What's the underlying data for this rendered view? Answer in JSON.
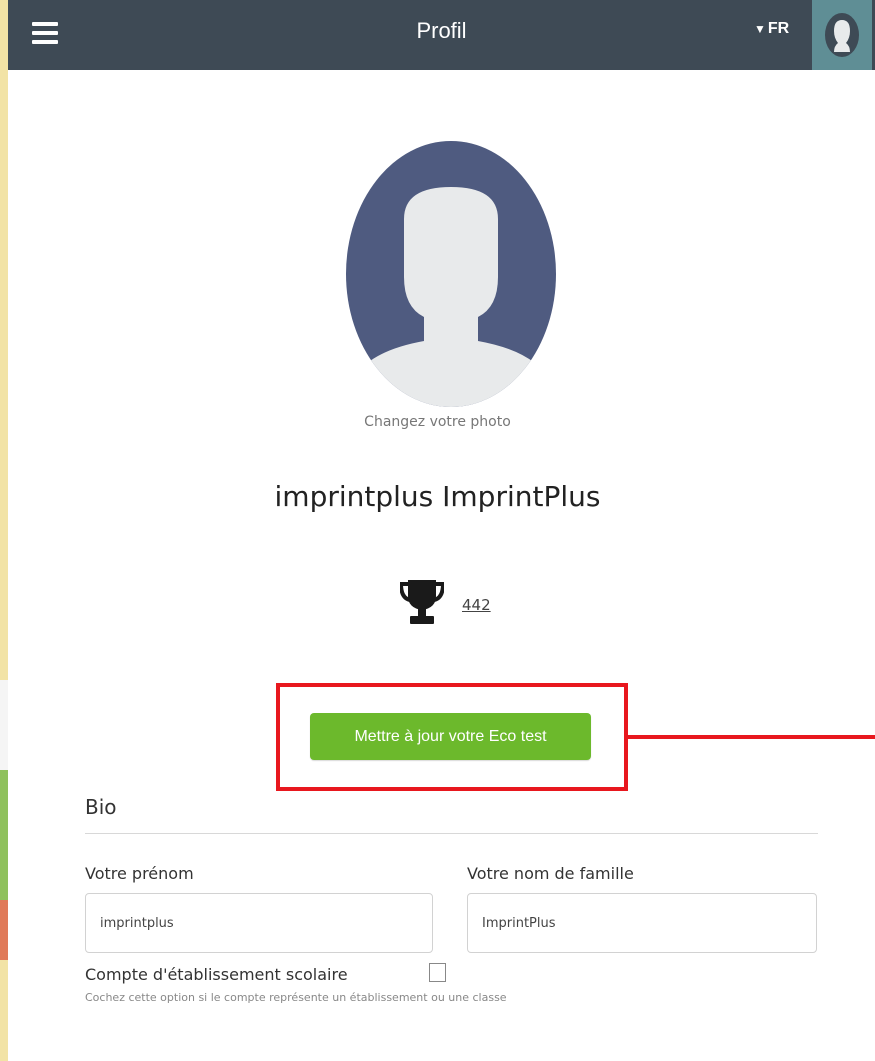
{
  "colors": {
    "topbar": "#3e4a55",
    "avatar_bg": "#4f5b80",
    "avatar_figure": "#e8eaeb",
    "button_green": "#6cb92c",
    "highlight_red": "#e8171e",
    "user_avatar_bg": "#5f8e95"
  },
  "header": {
    "menu_icon": "hamburger-icon",
    "title": "Profil",
    "language": "FR",
    "language_icon": "triangle-down-icon",
    "user_icon": "user-avatar-icon"
  },
  "profile": {
    "photo_icon": "person-silhouette-icon",
    "change_photo": "Changez votre photo",
    "name": "imprintplus ImprintPlus",
    "trophy_icon": "trophy-icon",
    "score": "442",
    "eco_button": "Mettre à jour votre Eco test"
  },
  "bio": {
    "heading": "Bio",
    "first_name_label": "Votre prénom",
    "first_name_value": "imprintplus",
    "last_name_label": "Votre nom de famille",
    "last_name_value": "ImprintPlus",
    "school_account_label": "Compte d'établissement scolaire",
    "school_account_checked": false,
    "school_account_help": "Cochez cette option si le compte représente un établissement ou une classe"
  }
}
